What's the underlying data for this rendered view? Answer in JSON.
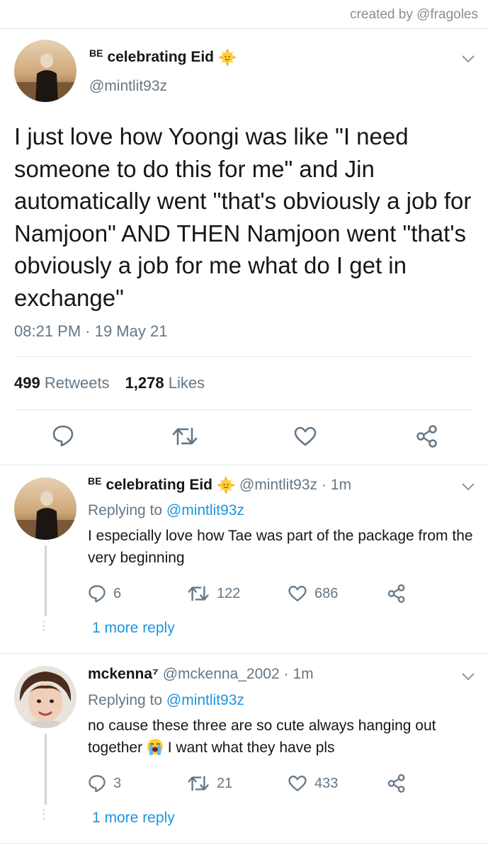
{
  "credit": "created by @fragoles",
  "main_tweet": {
    "display_name_prefix": "BE",
    "display_name": "celebrating Eid",
    "name_emoji": "sun-with-face-emoji",
    "handle": "@mintlit93z",
    "text": "I just love how Yoongi was like \"I need someone to do this for me\" and Jin automatically went \"that's obviously a job for Namjoon\" AND THEN Namjoon went \"that's obviously a job for me what do I get in exchange\"",
    "timestamp": "08:21 PM · 19 May 21",
    "retweets_count": "499",
    "retweets_label": "Retweets",
    "likes_count": "1,278",
    "likes_label": "Likes",
    "actions": [
      "reply-icon",
      "retweet-icon",
      "like-icon",
      "share-icon"
    ]
  },
  "replies": [
    {
      "display_name_prefix": "BE",
      "display_name": "celebrating Eid",
      "handle": "@mintlit93z",
      "time": "· 1m",
      "replying_label": "Replying to",
      "replying_handle": "@mintlit93z",
      "text": "I especially love how Tae was part of the package from the very beginning",
      "reply_count": "6",
      "retweet_count": "122",
      "like_count": "686",
      "more_reply": "1 more reply"
    },
    {
      "display_name": "mckenna⁷",
      "handle": "@mckenna_2002",
      "time": "· 1m",
      "replying_label": "Replying to",
      "replying_handle": "@mintlit93z",
      "text_before_emoji": "no cause these three are so cute always hanging out together",
      "text_emoji": "loudly-crying-face-emoji",
      "text_after_emoji": "I want what they have pls",
      "reply_count": "3",
      "retweet_count": "21",
      "like_count": "433",
      "more_reply": "1 more reply"
    }
  ],
  "colors": {
    "text": "#14171a",
    "muted": "#657786",
    "link": "#1b95e0",
    "divider": "#e1e8ed"
  }
}
